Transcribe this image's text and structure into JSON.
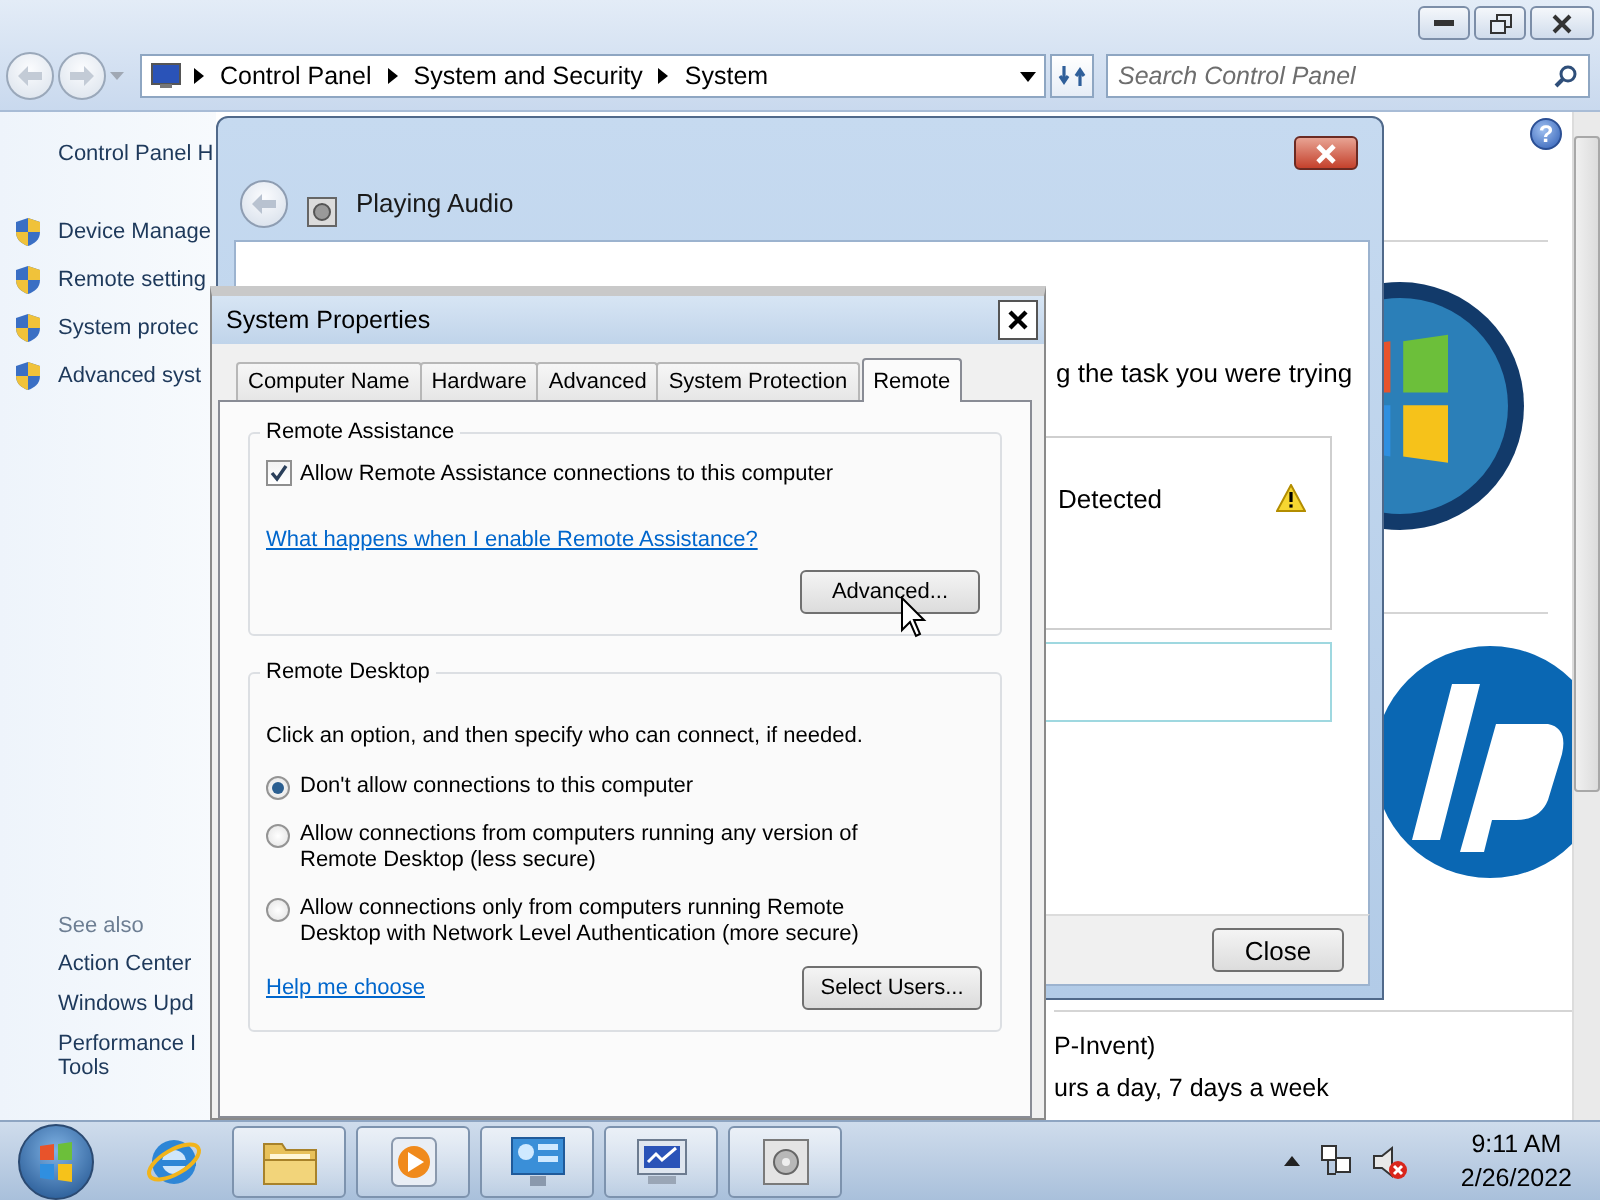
{
  "explorer": {
    "address": {
      "breadcrumb": [
        "Control Panel",
        "System and Security",
        "System"
      ]
    },
    "search": {
      "placeholder": "Search Control Panel"
    },
    "left_pane": {
      "home_link": "Control Panel H",
      "tasks": [
        "Device Manage",
        "Remote setting",
        "System protec",
        "Advanced syst"
      ],
      "see_also_heading": "See also",
      "see_also": [
        {
          "lines": [
            "Action Center"
          ]
        },
        {
          "lines": [
            "Windows Upd"
          ]
        },
        {
          "lines": [
            "Performance I",
            "Tools"
          ]
        }
      ]
    },
    "help_button": "?",
    "content_fragments": [
      "P-Invent)",
      "urs a day, 7 days a week"
    ]
  },
  "troubleshooter": {
    "title": "Playing Audio",
    "body_text": "g the task you were trying",
    "issue": "Detected",
    "close_button": "Close"
  },
  "system_properties": {
    "title": "System Properties",
    "tabs": [
      {
        "label": "Computer Name",
        "selected": false
      },
      {
        "label": "Hardware",
        "selected": false
      },
      {
        "label": "Advanced",
        "selected": false
      },
      {
        "label": "System Protection",
        "selected": false
      },
      {
        "label": "Remote",
        "selected": true
      }
    ],
    "remote_assistance": {
      "heading": "Remote Assistance",
      "allow": {
        "label": "Allow Remote Assistance connections to this computer",
        "checked": true
      },
      "help_link": "What happens when I enable Remote Assistance?",
      "advanced_button": "Advanced..."
    },
    "remote_desktop": {
      "heading": "Remote Desktop",
      "instruction": "Click an option, and then specify who can connect, if needed.",
      "options": [
        {
          "label": "Don't allow connections to this computer",
          "selected": true
        },
        {
          "label": "Allow connections from computers running any version of Remote Desktop (less secure)",
          "selected": false
        },
        {
          "label": "Allow connections only from computers running Remote Desktop with Network Level Authentication (more secure)",
          "selected": false
        }
      ],
      "help_link": "Help me choose",
      "select_users_button": "Select Users..."
    }
  },
  "taskbar": {
    "apps": [
      {
        "kind": "browser",
        "open": false
      },
      {
        "kind": "folder",
        "open": true
      },
      {
        "kind": "media",
        "open": true
      },
      {
        "kind": "dashboard",
        "open": true
      },
      {
        "kind": "system",
        "open": true
      },
      {
        "kind": "disc",
        "open": true
      }
    ],
    "clock": {
      "time": "9:11 AM",
      "date": "2/26/2022"
    }
  }
}
